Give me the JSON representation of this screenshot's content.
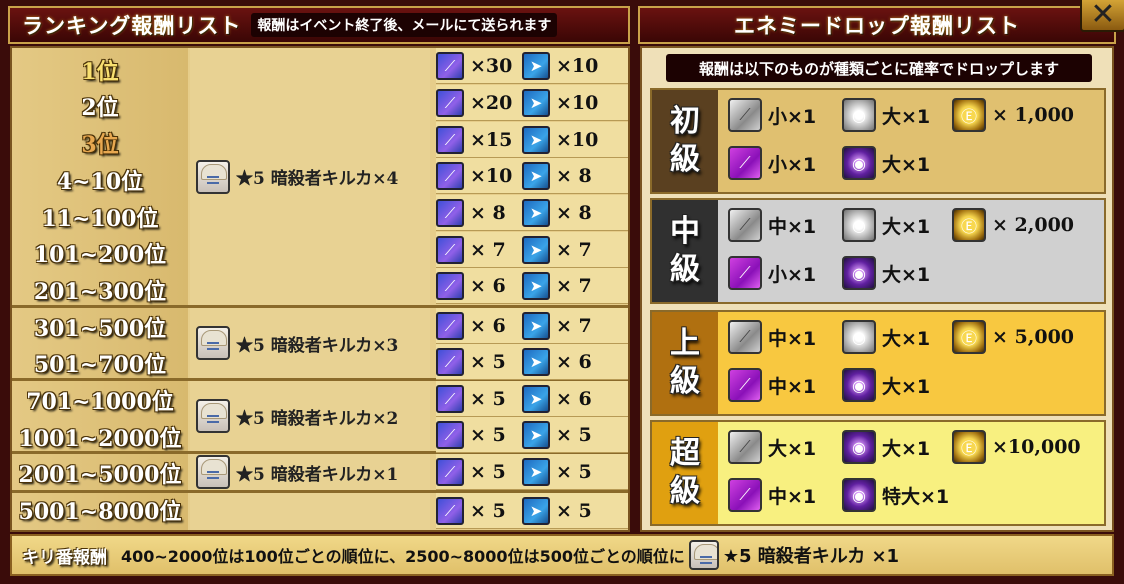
{
  "left_header": {
    "title": "ランキング報酬リスト",
    "note": "報酬はイベント終了後、メールにて送られます"
  },
  "right_header": {
    "title": "エネミードロップ報酬リスト"
  },
  "close_icon": "close-icon",
  "ranks": [
    "1位",
    "2位",
    "3位",
    "4~10位",
    "11~100位",
    "101~200位",
    "201~300位",
    "301~500位",
    "501~700位",
    "701~1000位",
    "1001~2000位",
    "2001~5000位",
    "5001~8000位"
  ],
  "rank_colors": {
    "first": "#f8e070",
    "second": "#ffffff",
    "third": "#e8a850"
  },
  "char_rewards": [
    {
      "text": "★5 暗殺者キルカ×4"
    },
    {
      "text": "★5 暗殺者キルカ×3"
    },
    {
      "text": "★5 暗殺者キルカ×2"
    },
    {
      "text": "★5 暗殺者キルカ×1"
    }
  ],
  "item_rows": [
    {
      "a": "×30",
      "b": "×10"
    },
    {
      "a": "×20",
      "b": "×10"
    },
    {
      "a": "×15",
      "b": "×10"
    },
    {
      "a": "×10",
      "b": "× 8"
    },
    {
      "a": "× 8",
      "b": "× 8"
    },
    {
      "a": "× 7",
      "b": "× 7"
    },
    {
      "a": "× 6",
      "b": "× 7"
    },
    {
      "a": "× 6",
      "b": "× 7"
    },
    {
      "a": "× 5",
      "b": "× 6"
    },
    {
      "a": "× 5",
      "b": "× 6"
    },
    {
      "a": "× 5",
      "b": "× 5"
    },
    {
      "a": "× 5",
      "b": "× 5"
    },
    {
      "a": "× 5",
      "b": "× 5"
    }
  ],
  "kiri": {
    "label": "キリ番報酬",
    "text": "400~2000位は100位ごとの順位に、2500~8000位は500位ごとの順位に",
    "reward": "★5 暗殺者キルカ ×1"
  },
  "drop_note": "報酬は以下のものが種類ごとに確率でドロップします",
  "tiers": [
    {
      "label": [
        "初",
        "級"
      ],
      "bg": "#e0c070",
      "label_bg": "#5a4020",
      "row1": [
        {
          "icon": "silver",
          "t": "小×1"
        },
        {
          "icon": "orb",
          "t": "大×1"
        },
        {
          "icon": "coin",
          "t": "× 1,000"
        }
      ],
      "row2": [
        {
          "icon": "purple",
          "t": "小×1"
        },
        {
          "icon": "porb",
          "t": "大×1"
        }
      ]
    },
    {
      "label": [
        "中",
        "級"
      ],
      "bg": "#d0d0d0",
      "label_bg": "#303030",
      "row1": [
        {
          "icon": "silver",
          "t": "中×1"
        },
        {
          "icon": "orb",
          "t": "大×1"
        },
        {
          "icon": "coin",
          "t": "× 2,000"
        }
      ],
      "row2": [
        {
          "icon": "purple",
          "t": "小×1"
        },
        {
          "icon": "porb",
          "t": "大×1"
        }
      ]
    },
    {
      "label": [
        "上",
        "級"
      ],
      "bg": "#f8c840",
      "label_bg": "#b07010",
      "row1": [
        {
          "icon": "silver",
          "t": "中×1"
        },
        {
          "icon": "orb",
          "t": "大×1"
        },
        {
          "icon": "coin",
          "t": "× 5,000"
        }
      ],
      "row2": [
        {
          "icon": "purple",
          "t": "中×1"
        },
        {
          "icon": "porb",
          "t": "大×1"
        }
      ]
    },
    {
      "label": [
        "超",
        "級"
      ],
      "bg": "#f8f080",
      "label_bg": "#e0a010",
      "row1": [
        {
          "icon": "silver",
          "t": "大×1"
        },
        {
          "icon": "porb",
          "t": "大×1"
        },
        {
          "icon": "coin",
          "t": "×10,000"
        }
      ],
      "row2": [
        {
          "icon": "purple",
          "t": "中×1"
        },
        {
          "icon": "porb",
          "t": "特大×1"
        }
      ]
    }
  ]
}
